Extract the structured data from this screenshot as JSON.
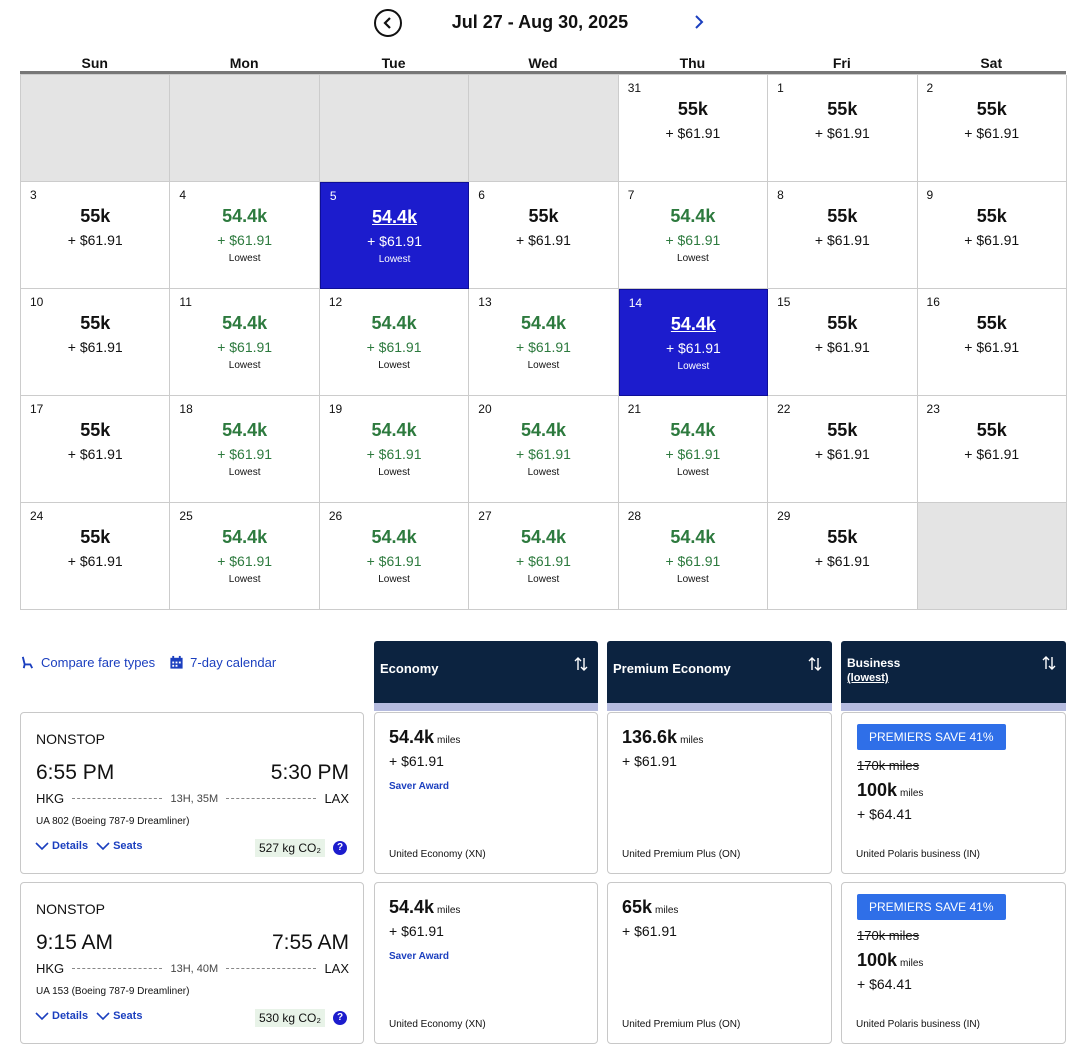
{
  "header": {
    "range": "Jul 27 - Aug 30, 2025"
  },
  "weekdays": [
    "Sun",
    "Mon",
    "Tue",
    "Wed",
    "Thu",
    "Fri",
    "Sat"
  ],
  "calendar": [
    {
      "empty": true
    },
    {
      "empty": true
    },
    {
      "empty": true
    },
    {
      "empty": true
    },
    {
      "day": "31",
      "miles": "55k",
      "tax": "+ $61.91"
    },
    {
      "day": "1",
      "miles": "55k",
      "tax": "+ $61.91"
    },
    {
      "day": "2",
      "miles": "55k",
      "tax": "+ $61.91"
    },
    {
      "day": "3",
      "miles": "55k",
      "tax": "+ $61.91"
    },
    {
      "day": "4",
      "miles": "54.4k",
      "tax": "+ $61.91",
      "tag": "Lowest"
    },
    {
      "day": "5",
      "miles": "54.4k",
      "tax": "+ $61.91",
      "tag": "Lowest",
      "selected": true
    },
    {
      "day": "6",
      "miles": "55k",
      "tax": "+ $61.91"
    },
    {
      "day": "7",
      "miles": "54.4k",
      "tax": "+ $61.91",
      "tag": "Lowest"
    },
    {
      "day": "8",
      "miles": "55k",
      "tax": "+ $61.91"
    },
    {
      "day": "9",
      "miles": "55k",
      "tax": "+ $61.91"
    },
    {
      "day": "10",
      "miles": "55k",
      "tax": "+ $61.91"
    },
    {
      "day": "11",
      "miles": "54.4k",
      "tax": "+ $61.91",
      "tag": "Lowest"
    },
    {
      "day": "12",
      "miles": "54.4k",
      "tax": "+ $61.91",
      "tag": "Lowest"
    },
    {
      "day": "13",
      "miles": "54.4k",
      "tax": "+ $61.91",
      "tag": "Lowest"
    },
    {
      "day": "14",
      "miles": "54.4k",
      "tax": "+ $61.91",
      "tag": "Lowest",
      "selected": true
    },
    {
      "day": "15",
      "miles": "55k",
      "tax": "+ $61.91"
    },
    {
      "day": "16",
      "miles": "55k",
      "tax": "+ $61.91"
    },
    {
      "day": "17",
      "miles": "55k",
      "tax": "+ $61.91"
    },
    {
      "day": "18",
      "miles": "54.4k",
      "tax": "+ $61.91",
      "tag": "Lowest"
    },
    {
      "day": "19",
      "miles": "54.4k",
      "tax": "+ $61.91",
      "tag": "Lowest"
    },
    {
      "day": "20",
      "miles": "54.4k",
      "tax": "+ $61.91",
      "tag": "Lowest"
    },
    {
      "day": "21",
      "miles": "54.4k",
      "tax": "+ $61.91",
      "tag": "Lowest"
    },
    {
      "day": "22",
      "miles": "55k",
      "tax": "+ $61.91"
    },
    {
      "day": "23",
      "miles": "55k",
      "tax": "+ $61.91"
    },
    {
      "day": "24",
      "miles": "55k",
      "tax": "+ $61.91"
    },
    {
      "day": "25",
      "miles": "54.4k",
      "tax": "+ $61.91",
      "tag": "Lowest"
    },
    {
      "day": "26",
      "miles": "54.4k",
      "tax": "+ $61.91",
      "tag": "Lowest"
    },
    {
      "day": "27",
      "miles": "54.4k",
      "tax": "+ $61.91",
      "tag": "Lowest"
    },
    {
      "day": "28",
      "miles": "54.4k",
      "tax": "+ $61.91",
      "tag": "Lowest"
    },
    {
      "day": "29",
      "miles": "55k",
      "tax": "+ $61.91"
    },
    {
      "empty": true
    }
  ],
  "tools": {
    "compare": "Compare fare types",
    "seven_day": "7-day calendar"
  },
  "columns": {
    "economy": "Economy",
    "premium": "Premium Economy",
    "business": "Business",
    "business_sub": "(lowest)"
  },
  "flights": [
    {
      "stops": "NONSTOP",
      "dep_time": "6:55 PM",
      "arr_time": "5:30 PM",
      "from": "HKG",
      "to": "LAX",
      "duration": "13H, 35M",
      "flight_no": "UA 802 (Boeing 787-9 Dreamliner)",
      "details": "Details",
      "seats": "Seats",
      "co2": "527 kg CO₂",
      "economy": {
        "miles": "54.4k",
        "unit": "miles",
        "tax": "+ $61.91",
        "award": "Saver Award",
        "cabin": "United Economy (XN)"
      },
      "premium": {
        "miles": "136.6k",
        "unit": "miles",
        "tax": "+ $61.91",
        "cabin": "United Premium Plus (ON)"
      },
      "business": {
        "badge": "PREMIERS SAVE 41%",
        "original": "170k miles",
        "miles": "100k",
        "unit": "miles",
        "tax": "+ $64.41",
        "cabin": "United Polaris business (IN)"
      }
    },
    {
      "stops": "NONSTOP",
      "dep_time": "9:15 AM",
      "arr_time": "7:55 AM",
      "from": "HKG",
      "to": "LAX",
      "duration": "13H, 40M",
      "flight_no": "UA 153 (Boeing 787-9 Dreamliner)",
      "details": "Details",
      "seats": "Seats",
      "co2": "530 kg CO₂",
      "economy": {
        "miles": "54.4k",
        "unit": "miles",
        "tax": "+ $61.91",
        "award": "Saver Award",
        "cabin": "United Economy (XN)"
      },
      "premium": {
        "miles": "65k",
        "unit": "miles",
        "tax": "+ $61.91",
        "cabin": "United Premium Plus (ON)"
      },
      "business": {
        "badge": "PREMIERS SAVE 41%",
        "original": "170k miles",
        "miles": "100k",
        "unit": "miles",
        "tax": "+ $64.41",
        "cabin": "United Polaris business (IN)"
      }
    }
  ]
}
